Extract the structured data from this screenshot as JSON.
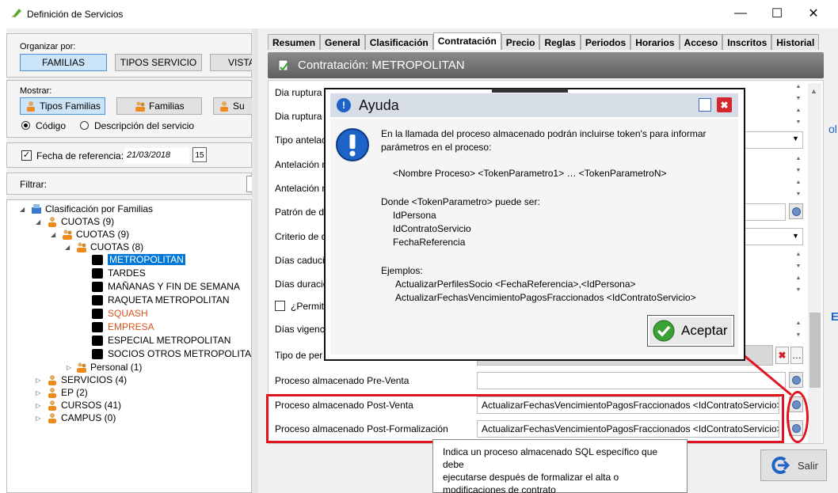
{
  "window": {
    "title": "Definición de Servicios",
    "min": "—",
    "max": "☐",
    "close": "✕"
  },
  "organize": {
    "label": "Organizar por:",
    "buttons": [
      "FAMILIAS",
      "TIPOS SERVICIO",
      "VISTA"
    ]
  },
  "show": {
    "label": "Mostrar:",
    "buttons": [
      "Tipos Familias",
      "Familias",
      "Su"
    ],
    "radio_code": "Código",
    "radio_desc": "Descripción del servicio"
  },
  "ref": {
    "label": "Fecha de referencia:",
    "value": "21/03/2018",
    "cal": "15"
  },
  "filter": {
    "label": "Filtrar:"
  },
  "tree": {
    "root": "Clasificación por Familias",
    "cuotas1": "CUOTAS (9)",
    "cuotas2": "CUOTAS (9)",
    "cuotas3": "CUOTAS (8)",
    "leaves": [
      "METROPOLITAN",
      "TARDES",
      "MAÑANAS Y FIN DE SEMANA",
      "RAQUETA METROPOLITAN",
      "SQUASH",
      "EMPRESA",
      "ESPECIAL METROPOLITAN",
      "SOCIOS OTROS METROPOLITAN"
    ],
    "personal": "Personal (1)",
    "others": [
      "SERVICIOS (4)",
      "EP (2)",
      "CURSOS (41)",
      "CAMPUS (0)"
    ]
  },
  "tabs": [
    "Resumen",
    "General",
    "Clasificación",
    "Contratación",
    "Precio",
    "Reglas",
    "Periodos",
    "Horarios",
    "Acceso",
    "Inscritos",
    "Historial"
  ],
  "header": "Contratación: METROPOLITAN",
  "form": {
    "labels": [
      "Dia ruptura",
      "Dia ruptura",
      "Tipo antelac",
      "Antelación m",
      "Antelación m",
      "Patrón de d",
      "Criterio de d",
      "Días caducio",
      "Días duració",
      "¿Permite",
      "Días vigenci",
      "Tipo de per",
      "Proceso almacenado Pre-Venta",
      "Proceso almacenado Post-Venta",
      "Proceso almacenado Post-Formalización"
    ],
    "postventa": "ActualizarFechasVencimientoPagosFraccionados <IdContratoServicio>",
    "postformal": "ActualizarFechasVencimientoPagosFraccionados <IdContratoServicio>"
  },
  "dialog": {
    "title": "Ayuda",
    "l1": "En la llamada del proceso almacenado podrán incluirse token's para informar",
    "l2": "parámetros en el proceso:",
    "l3": "<Nombre Proceso> <TokenParametro1> … <TokenParametroN>",
    "l4": "Donde <TokenParametro> puede ser:",
    "l5": "IdPersona",
    "l6": "IdContratoServicio",
    "l7": "FechaReferencia",
    "l8": "Ejemplos:",
    "l9": "ActualizarPerfilesSocio <FechaReferencia>,<IdPersona>",
    "l10": "ActualizarFechasVencimientoPagosFraccionados <IdContratoServicio>",
    "ok": "Aceptar"
  },
  "tooltip": {
    "l1": "Indica un proceso almacenado SQL específico que debe",
    "l2": "ejecutarse después de formalizar el alta o",
    "l3": "modificaciones de contrato"
  },
  "salir": "Salir",
  "edge": {
    "c1": "ol",
    "c2": "E"
  },
  "colors": {
    "accent": "#0078d7",
    "red": "#e0141e",
    "orange": "#d9531e"
  }
}
